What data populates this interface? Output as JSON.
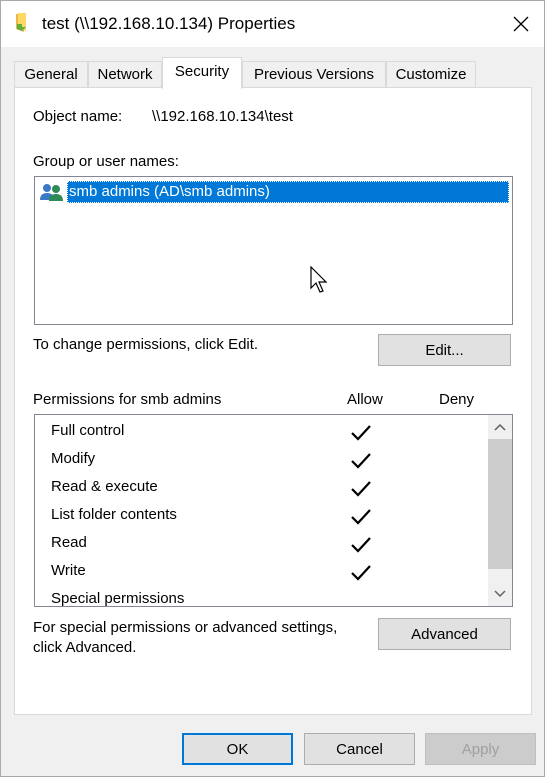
{
  "window": {
    "title": "test (\\\\192.168.10.134) Properties"
  },
  "tabs": [
    {
      "label": "General"
    },
    {
      "label": "Network"
    },
    {
      "label": "Security"
    },
    {
      "label": "Previous Versions"
    },
    {
      "label": "Customize"
    }
  ],
  "security": {
    "object_name_label": "Object name:",
    "object_name_value": "\\\\192.168.10.134\\test",
    "group_label": "Group or user names:",
    "users": [
      {
        "name": "smb admins (AD\\smb admins)",
        "selected": true
      }
    ],
    "change_text": "To change permissions, click Edit.",
    "edit_button": "Edit...",
    "permissions_for": "Permissions for smb admins",
    "allow_header": "Allow",
    "deny_header": "Deny",
    "permissions": [
      {
        "name": "Full control",
        "allow": true,
        "deny": false
      },
      {
        "name": "Modify",
        "allow": true,
        "deny": false
      },
      {
        "name": "Read & execute",
        "allow": true,
        "deny": false
      },
      {
        "name": "List folder contents",
        "allow": true,
        "deny": false
      },
      {
        "name": "Read",
        "allow": true,
        "deny": false
      },
      {
        "name": "Write",
        "allow": true,
        "deny": false
      },
      {
        "name": "Special permissions",
        "allow": false,
        "deny": false
      }
    ],
    "special_text_line1": "For special permissions or advanced settings,",
    "special_text_line2": "click Advanced.",
    "advanced_button": "Advanced"
  },
  "footer": {
    "ok": "OK",
    "cancel": "Cancel",
    "apply": "Apply"
  },
  "colors": {
    "selection": "#0078d7",
    "folder": "#ffd766",
    "users_icon": "#3a78c8"
  },
  "icons": {
    "title": "shared-folder-icon",
    "close": "close-icon",
    "users": "users-icon",
    "check": "checkmark-icon",
    "scroll_up": "chevron-up-icon",
    "scroll_down": "chevron-down-icon"
  }
}
